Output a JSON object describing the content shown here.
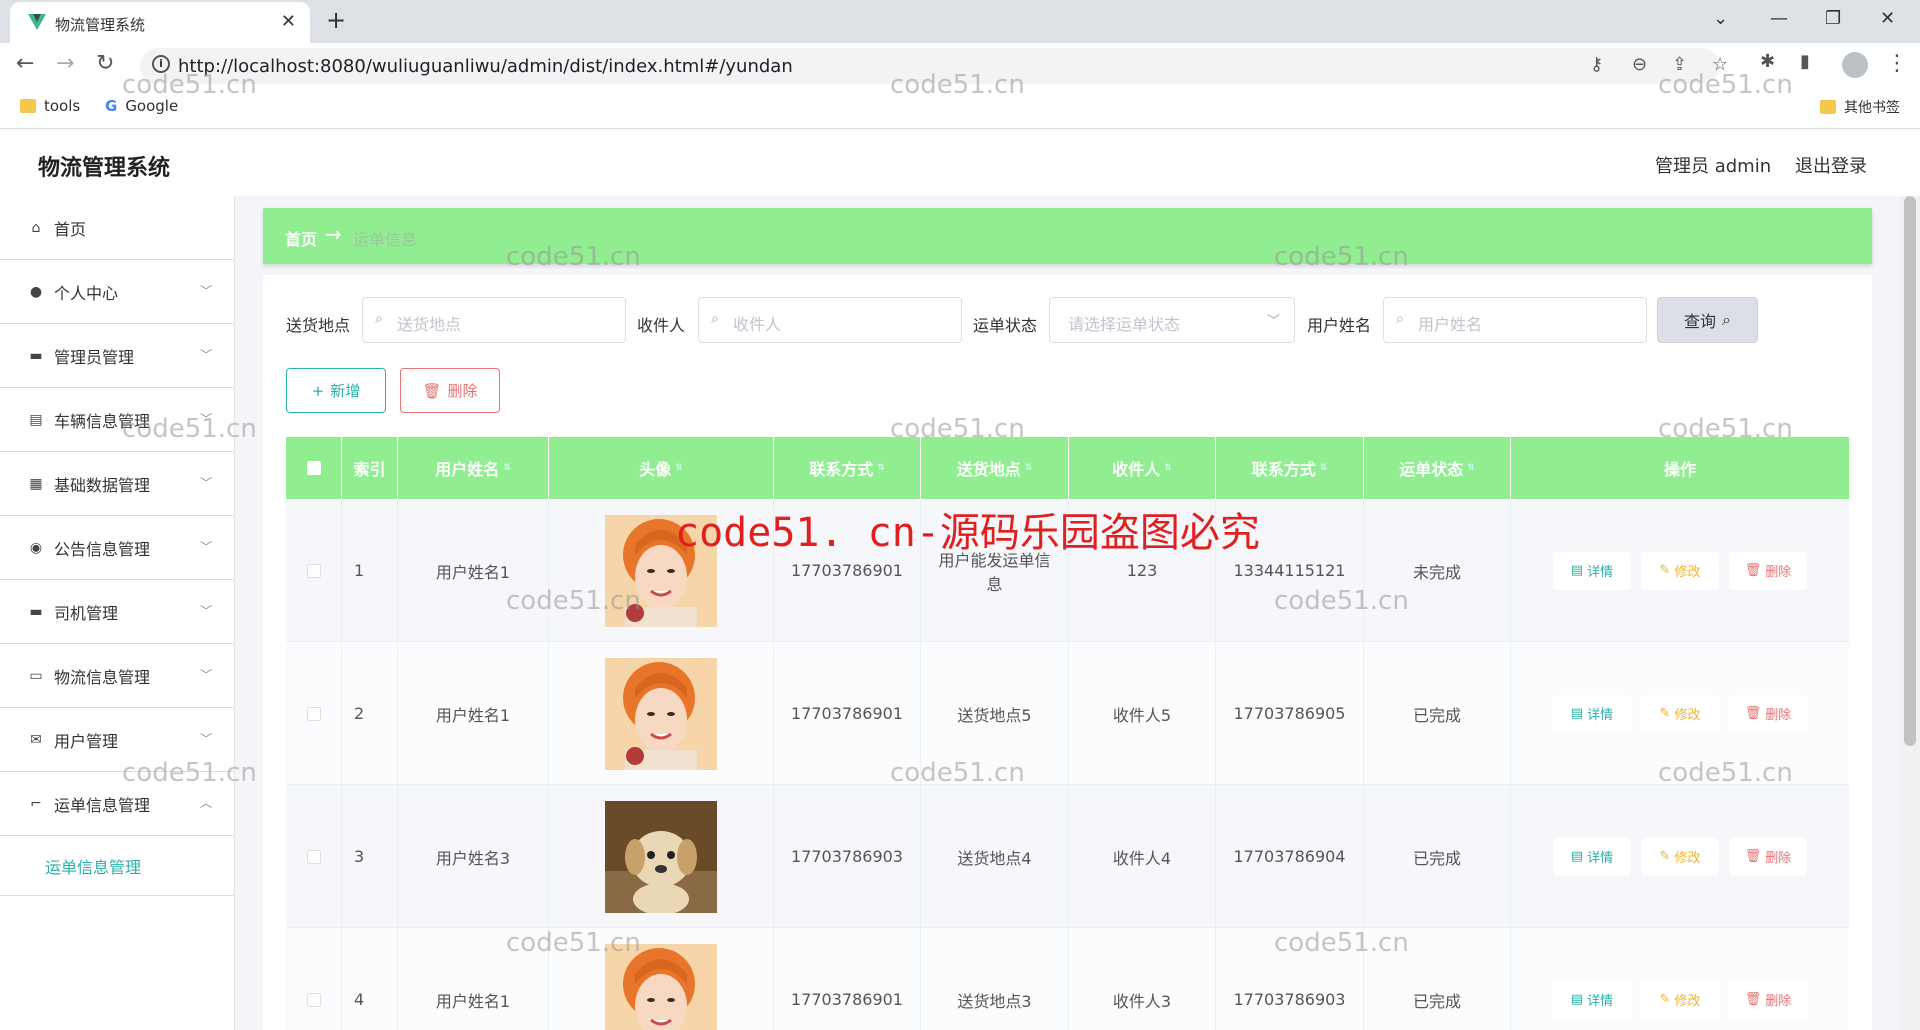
{
  "browser": {
    "tab_title": "物流管理系统",
    "url": "http://localhost:8080/wuliuguanliwu/admin/dist/index.html#/yundan",
    "bookmarks": [
      {
        "label": "tools",
        "icon": "folder-icon"
      },
      {
        "label": "Google",
        "icon": "google-icon"
      }
    ],
    "other_bookmarks": "其他书签"
  },
  "header": {
    "app_title": "物流管理系统",
    "admin_label": "管理员 admin",
    "logout_label": "退出登录"
  },
  "sidebar": {
    "items": [
      {
        "label": "首页",
        "icon": "home-icon",
        "expandable": false
      },
      {
        "label": "个人中心",
        "icon": "user-icon",
        "expandable": true
      },
      {
        "label": "管理员管理",
        "icon": "chat-icon",
        "expandable": true
      },
      {
        "label": "车辆信息管理",
        "icon": "clipboard-icon",
        "expandable": true
      },
      {
        "label": "基础数据管理",
        "icon": "grid-icon",
        "expandable": true
      },
      {
        "label": "公告信息管理",
        "icon": "pin-icon",
        "expandable": true
      },
      {
        "label": "司机管理",
        "icon": "card-icon",
        "expandable": true
      },
      {
        "label": "物流信息管理",
        "icon": "message-icon",
        "expandable": true
      },
      {
        "label": "用户管理",
        "icon": "mail-icon",
        "expandable": true
      },
      {
        "label": "运单信息管理",
        "icon": "crop-icon",
        "expandable": true,
        "expanded": true
      }
    ],
    "active_sub": "运单信息管理"
  },
  "breadcrumb": {
    "home": "首页",
    "current": "运单信息"
  },
  "search": {
    "fields": [
      {
        "label": "送货地点",
        "placeholder": "送货地点"
      },
      {
        "label": "收件人",
        "placeholder": "收件人"
      },
      {
        "label": "运单状态",
        "placeholder": "请选择运单状态"
      },
      {
        "label": "用户姓名",
        "placeholder": "用户姓名"
      }
    ],
    "query_label": "查询"
  },
  "actions": {
    "add_label": "新增",
    "delete_label": "删除"
  },
  "table": {
    "columns": [
      "索引",
      "用户姓名",
      "头像",
      "联系方式",
      "送货地点",
      "收件人",
      "联系方式",
      "运单状态",
      "操作"
    ],
    "rows": [
      {
        "index": "1",
        "user_name": "用户姓名1",
        "avatar": "girl-photo",
        "phone": "17703786901",
        "address": "用户能发运单信息",
        "receiver": "123",
        "receiver_phone": "13344115121",
        "status": "未完成"
      },
      {
        "index": "2",
        "user_name": "用户姓名1",
        "avatar": "girl-photo",
        "phone": "17703786901",
        "address": "送货地点5",
        "receiver": "收件人5",
        "receiver_phone": "17703786905",
        "status": "已完成"
      },
      {
        "index": "3",
        "user_name": "用户姓名3",
        "avatar": "puppy-photo",
        "phone": "17703786903",
        "address": "送货地点4",
        "receiver": "收件人4",
        "receiver_phone": "17703786904",
        "status": "已完成"
      },
      {
        "index": "4",
        "user_name": "用户姓名1",
        "avatar": "girl-photo",
        "phone": "17703786901",
        "address": "送货地点3",
        "receiver": "收件人3",
        "receiver_phone": "17703786903",
        "status": "已完成"
      }
    ],
    "op_labels": {
      "detail": "详情",
      "edit": "修改",
      "delete": "删除"
    }
  },
  "watermarks": {
    "small": "code51.cn",
    "big": "code51. cn-源码乐园盗图必究"
  },
  "colors": {
    "accent_green": "#90ee90",
    "teal": "#2ab0a8",
    "danger": "#e57373",
    "warning": "#f0b429"
  }
}
